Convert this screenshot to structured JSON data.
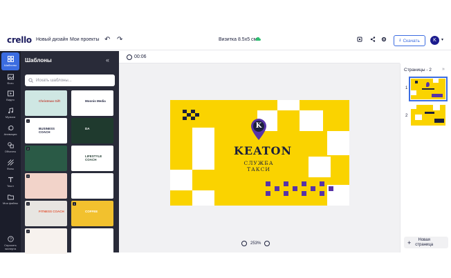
{
  "header": {
    "logo": "crello",
    "nav": [
      "Новый дизайн",
      "Мои проекты"
    ],
    "doc_title": "Визитка 8.5x5 см",
    "share_label": "Скачать",
    "avatar_letter": "K"
  },
  "rail": {
    "items": [
      {
        "label": "Шаблоны",
        "icon": "templates-icon"
      },
      {
        "label": "Фото",
        "icon": "photo-icon"
      },
      {
        "label": "Видео",
        "icon": "video-icon"
      },
      {
        "label": "Музыка",
        "icon": "music-icon"
      },
      {
        "label": "Анимация",
        "icon": "animation-icon"
      },
      {
        "label": "Объекты",
        "icon": "objects-icon"
      },
      {
        "label": "Фоны",
        "icon": "backgrounds-icon"
      },
      {
        "label": "Текст",
        "icon": "text-icon"
      },
      {
        "label": "Мои файлы",
        "icon": "myfiles-icon"
      },
      {
        "label": "Спросить\nэксперта",
        "icon": "help-icon"
      }
    ]
  },
  "panel": {
    "title": "Шаблоны",
    "search_placeholder": "Искать шаблоны...",
    "templates": [
      {
        "num": "",
        "text": "Christmas Gift",
        "bg": "#cfe7e3",
        "fg": "#c1453b"
      },
      {
        "num": "",
        "text": "Moonis Media",
        "bg": "#ffffff",
        "fg": "#1b1f3b"
      },
      {
        "num": "1",
        "text": "BUSINESS COACH",
        "bg": "#ffffff",
        "fg": "#1b1f3b"
      },
      {
        "num": "",
        "text": "DA",
        "bg": "#1f3a2e",
        "fg": "#ffffff"
      },
      {
        "num": "2",
        "text": "",
        "bg": "#2a5a46",
        "fg": "#ffffff"
      },
      {
        "num": "",
        "text": "LIFESTYLE COACH",
        "bg": "#ffffff",
        "fg": "#1f3a2e"
      },
      {
        "num": "2",
        "text": "",
        "bg": "#f2d3c9",
        "fg": "#1b1f3b"
      },
      {
        "num": "",
        "text": "",
        "bg": "#ffffff",
        "fg": "#1b1f3b"
      },
      {
        "num": "1",
        "text": "FITNESS COACH",
        "bg": "#e7e5e1",
        "fg": "#e25a3c"
      },
      {
        "num": "1",
        "text": "COFFEE",
        "bg": "#f2c12e",
        "fg": "#ffffff"
      },
      {
        "num": "2",
        "text": "",
        "bg": "#f7f2ee",
        "fg": "#1b1f3b"
      },
      {
        "num": "",
        "text": "",
        "bg": "#ffffff",
        "fg": "#5733a8"
      }
    ]
  },
  "timer": "00:06",
  "canvas": {
    "brand": "KEATON",
    "tagline": "СЛУЖБА\nТАКСИ",
    "pin_letter": "K",
    "accent": "#fad300",
    "purple": "#5733a8"
  },
  "zoom": "253%",
  "pages": {
    "title": "Страницы - 2",
    "list": [
      {
        "num": "1"
      },
      {
        "num": "2"
      }
    ],
    "new_page": "Новая\nстраница"
  }
}
